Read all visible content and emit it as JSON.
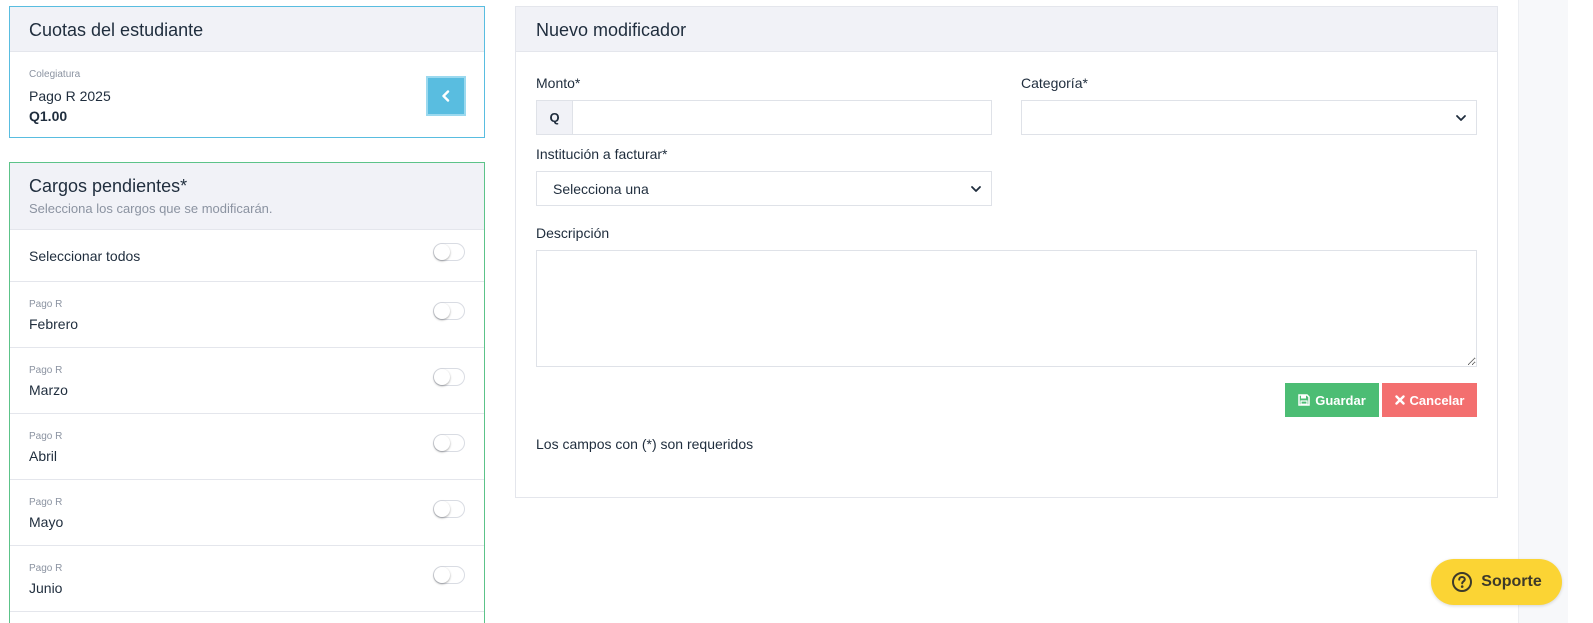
{
  "cuotas": {
    "title": "Cuotas del estudiante",
    "item": {
      "category": "Colegiatura",
      "name": "Pago R 2025",
      "amount": "Q1.00"
    },
    "back_icon": "chevron-left-icon"
  },
  "cargos": {
    "title": "Cargos pendientes*",
    "subtitle": "Selecciona los cargos que se modificarán.",
    "select_all_label": "Seleccionar todos",
    "items": [
      {
        "category": "Pago R",
        "name": "Febrero"
      },
      {
        "category": "Pago R",
        "name": "Marzo"
      },
      {
        "category": "Pago R",
        "name": "Abril"
      },
      {
        "category": "Pago R",
        "name": "Mayo"
      },
      {
        "category": "Pago R",
        "name": "Junio"
      }
    ]
  },
  "form": {
    "title": "Nuevo modificador",
    "monto_label": "Monto*",
    "monto_prefix": "Q",
    "monto_value": "",
    "categoria_label": "Categoría*",
    "categoria_value": "",
    "institucion_label": "Institución a facturar*",
    "institucion_value": "Selecciona una",
    "descripcion_label": "Descripción",
    "descripcion_value": "",
    "save_label": "Guardar",
    "cancel_label": "Cancelar",
    "required_note": "Los campos con (*) son requeridos"
  },
  "support": {
    "label": "Soporte",
    "icon": "question-circle-icon"
  },
  "colors": {
    "info": "#59bde0",
    "success": "#4cbd74",
    "danger": "#f36f6f",
    "support": "#fbd434",
    "header_bg": "#f1f2f7"
  }
}
